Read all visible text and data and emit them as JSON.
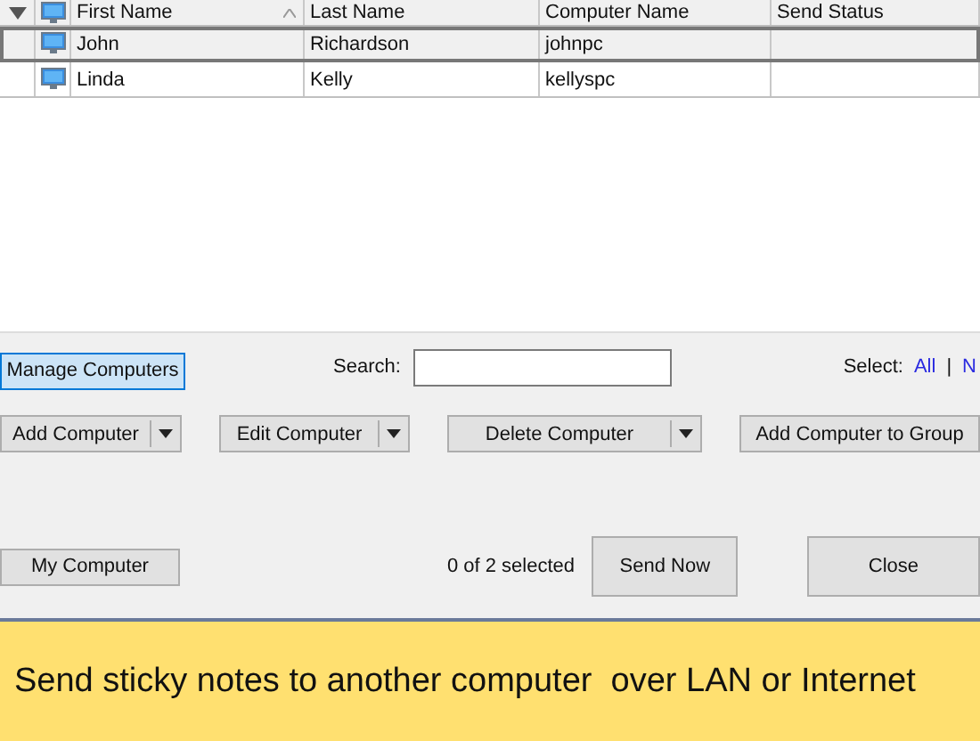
{
  "table": {
    "columns": [
      {
        "label": "First Name",
        "sorted": true
      },
      {
        "label": "Last Name",
        "sorted": false
      },
      {
        "label": "Computer Name",
        "sorted": false
      },
      {
        "label": "Send Status",
        "sorted": false
      }
    ],
    "rows": [
      {
        "first_name": "John",
        "last_name": "Richardson",
        "computer_name": "johnpc",
        "selected": true
      },
      {
        "first_name": "Linda",
        "last_name": "Kelly",
        "computer_name": "kellyspc",
        "selected": false
      }
    ]
  },
  "toolbar": {
    "manage_button": {
      "label": "Manage Computers",
      "selected": true
    },
    "search": {
      "label": "Search:"
    },
    "select": {
      "label": "Select:",
      "links": [
        "All",
        "N"
      ],
      "separator": "|"
    }
  },
  "actions": [
    {
      "label": "Add Computer",
      "kind": "split"
    },
    {
      "label": "Edit Computer",
      "kind": "split"
    },
    {
      "label": "Delete Computer",
      "kind": "split"
    },
    {
      "label": "Add Computer to Group",
      "kind": "plain"
    }
  ],
  "footer": {
    "my_computer": "My Computer",
    "status": "0 of 2 selected",
    "buttons": [
      "Send Now",
      "Close"
    ]
  },
  "banner": {
    "text": "Send sticky notes to another computer  over LAN or Internet"
  }
}
